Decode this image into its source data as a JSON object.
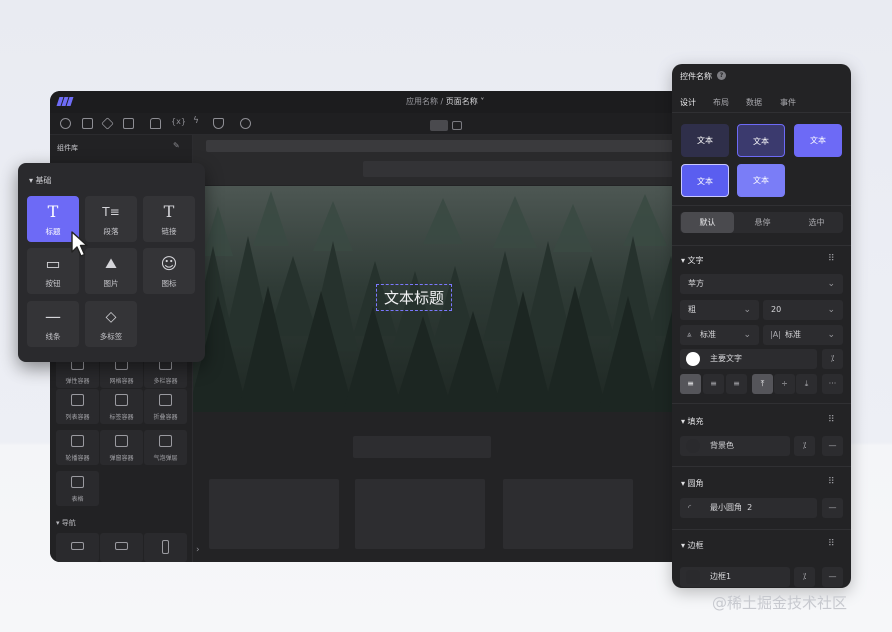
{
  "editor": {
    "breadcrumb": {
      "app": "应用名称",
      "sep": "/",
      "page": "页面名称 ˅"
    },
    "sidebar": {
      "title": "组件库",
      "containers": [
        {
          "label": "弹性容器",
          "icon": "flex-container-icon"
        },
        {
          "label": "网格容器",
          "icon": "grid-container-icon"
        },
        {
          "label": "多栏容器",
          "icon": "multi-column-container-icon"
        },
        {
          "label": "列表容器",
          "icon": "list-container-icon"
        },
        {
          "label": "标签容器",
          "icon": "tabs-container-icon"
        },
        {
          "label": "折叠容器",
          "icon": "collapse-container-icon"
        },
        {
          "label": "轮播容器",
          "icon": "carousel-container-icon"
        },
        {
          "label": "弹窗容器",
          "icon": "modal-container-icon"
        },
        {
          "label": "气泡弹层",
          "icon": "popover-icon"
        },
        {
          "label": "表格",
          "icon": "table-icon"
        }
      ],
      "nav_section": "▾ 导航"
    },
    "canvas": {
      "hero_title": "文本标题",
      "expand": "›"
    }
  },
  "popup": {
    "section": "▾ 基础",
    "items": [
      {
        "label": "标题",
        "glyph": "T",
        "selected": true
      },
      {
        "label": "段落",
        "glyph": "T≡",
        "selected": false
      },
      {
        "label": "链接",
        "glyph": "T",
        "selected": false
      },
      {
        "label": "按钮",
        "glyph": "▭",
        "selected": false
      },
      {
        "label": "图片",
        "glyph": "⛰",
        "selected": false
      },
      {
        "label": "图标",
        "glyph": "☺",
        "selected": false
      },
      {
        "label": "线条",
        "glyph": "—",
        "selected": false
      },
      {
        "label": "多标签",
        "glyph": "◇",
        "selected": false
      }
    ]
  },
  "panel": {
    "title": "控件名称",
    "help": "?",
    "tabs": [
      "设计",
      "布局",
      "数据",
      "事件"
    ],
    "active_tab": "设计",
    "style_presets": [
      {
        "label": "文本",
        "bg": "#2f2f4a",
        "border": "none"
      },
      {
        "label": "文本",
        "bg": "#3b3a6e",
        "border": "#6d6af6"
      },
      {
        "label": "文本",
        "bg": "#6d6af6",
        "border": "none"
      },
      {
        "label": "文本",
        "bg": "#5a5ef0",
        "border": "#c9c8ff"
      },
      {
        "label": "文本",
        "bg": "#7a7df7",
        "border": "none"
      }
    ],
    "states": [
      "默认",
      "悬停",
      "选中"
    ],
    "active_state": "默认",
    "text": {
      "heading": "▾ 文字",
      "font_family": "苹方",
      "font_weight": "粗",
      "font_size": "20",
      "letter_spacing": "标准",
      "line_height": "标准",
      "color_label": "主要文字"
    },
    "fill": {
      "heading": "▾ 填充",
      "label": "背景色"
    },
    "radius": {
      "heading": "▾ 圆角",
      "label": "最小圆角",
      "value": "2"
    },
    "border": {
      "heading": "▾ 边框",
      "label": "边框1"
    },
    "menu_dots": "⠿",
    "minus": "—",
    "percent": "⁒",
    "more": "···"
  },
  "watermark": "@稀土掘金技术社区",
  "colors": {
    "accent": "#6d6af6",
    "bg_dark": "#1f1f21",
    "panel": "#232325"
  }
}
